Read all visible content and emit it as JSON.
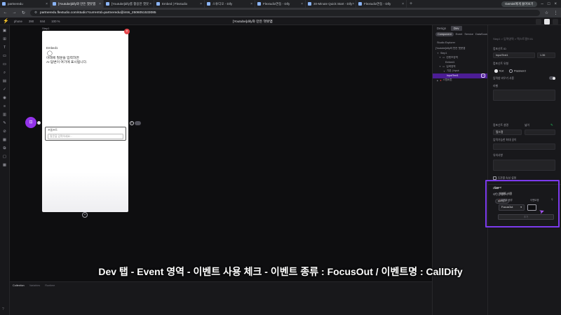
{
  "browser": {
    "tabs": [
      {
        "label": "partneredu",
        "active": false
      },
      {
        "label": "[Youtube]dify와 만든 챗봇앱",
        "active": true
      },
      {
        "label": "[Youtube]dify를 활용한 챗봇",
        "active": false
      },
      {
        "label": "Embed | Flextudio",
        "active": false
      },
      {
        "label": "스튜디오 - Dify",
        "active": false
      },
      {
        "label": "Flextudio연동 - Dify",
        "active": false
      },
      {
        "label": "30-Minute Quick Start - Dify",
        "active": false
      },
      {
        "label": "Flextudio연동 - Dify",
        "active": false
      }
    ],
    "gemini_button": "Gemini에게 물어보기",
    "url": "partneredu.flextudio.com/studio?currentId=partneredu@imts_2506051533085"
  },
  "app": {
    "toolbar_items": [
      "phone",
      "390",
      "844",
      "100 %"
    ],
    "title": "[Youtube]dify와 만든 챗봇앱",
    "right_buttons": [
      "",
      "",
      ""
    ]
  },
  "canvas": {
    "step_label": "Step1",
    "embed_title": "Embed1",
    "hint_line1": "아래에 질문을 입력하면",
    "hint_line2": "AI 답변이 여기에 표시됩니다.",
    "input_label": "프롬프트",
    "input_placeholder": "질문을 입력하세요..."
  },
  "console": {
    "tabs": [
      "Collection",
      "Variables",
      "Runtime"
    ],
    "lines": [
      "",
      ""
    ]
  },
  "explorer": {
    "top_tabs": [
      "Design",
      "Dev"
    ],
    "sub_tabs": [
      "Component",
      "Event",
      "Service",
      "DataSource",
      "Etc"
    ],
    "title": "Studio Explorer",
    "tree": [
      {
        "label": "[Youtube]dify와 만든 챗봇앱",
        "indent": 0
      },
      {
        "label": "Step1",
        "indent": 1
      },
      {
        "label": "컨텐츠영역",
        "indent": 2
      },
      {
        "label": "Embed1",
        "indent": 3
      },
      {
        "label": "입력영역",
        "indent": 2
      },
      {
        "label": "기본 | Input",
        "indent": 3
      },
      {
        "label": "InputText1",
        "indent": 3,
        "selected": true,
        "badge": "T"
      },
      {
        "label": "스텝버튼",
        "indent": 1,
        "red": true
      }
    ]
  },
  "props": {
    "crumb": "Step1 > 입력영역 > 텍스트필드01",
    "component_id_label": "컴포넌트 ID",
    "component_id": "InputText1",
    "width_value": "1.36",
    "type_label": "컴포넌트 유형",
    "type_options": [
      "Text",
      "Password"
    ],
    "toggle_label": "입력창 비우기 사용",
    "label_label": "라벨",
    "component_name_label": "컴포넌트 설명",
    "component_name": "필드명",
    "width_label": "넓이",
    "placeholder_label": "입력가능한 최대 길이",
    "tooltip_label": "유의사항",
    "condition_label": "조건별 속성 설정",
    "data_label": "Data",
    "data_bind_label": "바인딩데이터",
    "query_chip": "query",
    "event_label": "Event",
    "event_use": "이벤트 사용",
    "event_type_label": "이벤트 종류",
    "event_name_label": "이벤트명",
    "event_type_value": "FocusOut",
    "event_add": "추가"
  },
  "caption": "Dev 탭 - Event 영역 - 이벤트 사용 체크 - 이벤트 종류 : FocusOut / 이벤트명 : CallDify"
}
